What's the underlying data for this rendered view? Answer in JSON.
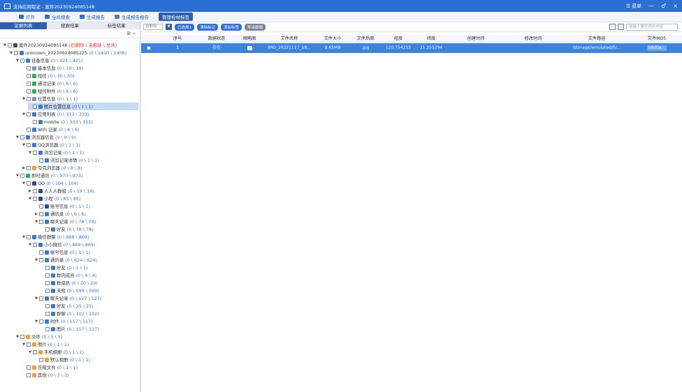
{
  "window": {
    "title": "支持应用取证 - 案件20230924085148",
    "menu_label": "菜单",
    "minimize": "—",
    "maximize": "♂",
    "close": "×"
  },
  "toolbar": {
    "buttons": [
      {
        "label": "打开"
      },
      {
        "label": "全局搜索"
      },
      {
        "label": "生成报告"
      },
      {
        "label": "生成报告报告"
      },
      {
        "label": "管理检材标签"
      }
    ]
  },
  "left_tabs": [
    "证据列表",
    "搜索结果",
    "标签结果"
  ],
  "tree": [
    {
      "text": "案件20230924085148",
      "count": "(已删除 \\ 未删除 \\ 总共)",
      "arrow": "▼",
      "indent": 0,
      "icon": "dark"
    },
    {
      "text": "unknown_20230924085225",
      "count": "(0 \\ 1400 \\ 1406)",
      "arrow": "▼",
      "indent": 1,
      "icon": "blue"
    },
    {
      "text": "设备信息",
      "count": "(0 \\ 421 \\ 421)",
      "arrow": "▼",
      "indent": 2,
      "icon": "blue"
    },
    {
      "text": "基本信息",
      "count": "(0 \\ 19 \\ 19)",
      "arrow": "",
      "indent": 3,
      "icon": "gray"
    },
    {
      "text": "短信",
      "count": "(0 \\ 30 \\ 30)",
      "arrow": "",
      "indent": 3,
      "icon": "green"
    },
    {
      "text": "通话记录",
      "count": "(0 \\ 6 \\ 6)",
      "arrow": "",
      "indent": 3,
      "icon": "green"
    },
    {
      "text": "短信附件",
      "count": "(0 \\ 6 \\ 6)",
      "arrow": "",
      "indent": 3,
      "icon": "green"
    },
    {
      "text": "位置信息",
      "count": "(0 \\ 1 \\ 1)",
      "arrow": "▼",
      "indent": 3,
      "icon": "gray"
    },
    {
      "text": "图片位置信息",
      "count": "(0 \\ 1 \\ 1)",
      "arrow": "",
      "indent": 4,
      "icon": "blue",
      "selected": true
    },
    {
      "text": "应用列表",
      "count": "(0 \\ 333 \\ 333)",
      "arrow": "▼",
      "indent": 3,
      "icon": "blue"
    },
    {
      "text": "mobile",
      "count": "(0 \\ 333 \\ 333)",
      "arrow": "",
      "indent": 4,
      "icon": "blue"
    },
    {
      "text": "WiFi 记录",
      "count": "(0 \\ 6 \\ 6)",
      "arrow": "",
      "indent": 3,
      "icon": "blue"
    },
    {
      "text": "浏览器信息",
      "count": "(0 \\ 9 \\ 9)",
      "arrow": "▼",
      "indent": 2,
      "icon": "blue"
    },
    {
      "text": "QQ浏览器",
      "count": "(0 \\ 1 \\ 1)",
      "arrow": "▼",
      "indent": 3,
      "icon": "blue"
    },
    {
      "text": "浏览记录",
      "count": "(0 \\ 1 \\ 1)",
      "arrow": "▼",
      "indent": 4,
      "icon": "blue"
    },
    {
      "text": "浏览记录详情",
      "count": "(0 \\ 1 \\ 1)",
      "arrow": "",
      "indent": 5,
      "icon": "blue"
    },
    {
      "text": "夸克浏览器",
      "count": "(0 \\ 8 \\ 8)",
      "arrow": "▶",
      "indent": 3,
      "icon": "orange"
    },
    {
      "text": "即时通讯",
      "count": "(0 \\ 973 \\ 973)",
      "arrow": "▼",
      "indent": 2,
      "icon": "green"
    },
    {
      "text": "QQ",
      "count": "(0 \\ 104 \\ 104)",
      "arrow": "▼",
      "indent": 3,
      "icon": "dark"
    },
    {
      "text": "人人人群组",
      "count": "(0 \\ 19 \\ 19)",
      "arrow": "▶",
      "indent": 4,
      "icon": "dark"
    },
    {
      "text": "小程",
      "count": "(0 \\ 85 \\ 85)",
      "arrow": "▼",
      "indent": 4,
      "icon": "dark"
    },
    {
      "text": "账号信息",
      "count": "(0 \\ 1 \\ 1)",
      "arrow": "",
      "indent": 5,
      "icon": "dark"
    },
    {
      "text": "通讯录",
      "count": "(0 \\ 6 \\ 6)",
      "arrow": "▶",
      "indent": 5,
      "icon": "blue"
    },
    {
      "text": "聊天记录",
      "count": "(0 \\ 78 \\ 78)",
      "arrow": "▼",
      "indent": 5,
      "icon": "blue"
    },
    {
      "text": "好友",
      "count": "(0 \\ 78 \\ 78)",
      "arrow": "",
      "indent": 6,
      "icon": "blue"
    },
    {
      "text": "微信群聊",
      "count": "(0 \\ 869 \\ 869)",
      "arrow": "▼",
      "indent": 3,
      "icon": "blue"
    },
    {
      "text": "小小微信",
      "count": "(0 \\ 869 \\ 869)",
      "arrow": "▼",
      "indent": 4,
      "icon": "blue"
    },
    {
      "text": "账号信息",
      "count": "(0 \\ 1 \\ 1)",
      "arrow": "",
      "indent": 5,
      "icon": "blue"
    },
    {
      "text": "通讯录",
      "count": "(0 \\ 624 \\ 624)",
      "arrow": "▼",
      "indent": 5,
      "icon": "blue"
    },
    {
      "text": "好友",
      "count": "(0 \\ 1 \\ 1)",
      "arrow": "",
      "indent": 6,
      "icon": "blue"
    },
    {
      "text": "群内成员",
      "count": "(0 \\ 4 \\ 4)",
      "arrow": "",
      "indent": 6,
      "icon": "blue"
    },
    {
      "text": "群成员",
      "count": "(0 \\ 20 \\ 20)",
      "arrow": "",
      "indent": 6,
      "icon": "blue"
    },
    {
      "text": "未知",
      "count": "(0 \\ 599 \\ 599)",
      "arrow": "",
      "indent": 6,
      "icon": "blue"
    },
    {
      "text": "聊天记录",
      "count": "(0 \\ 127 \\ 127)",
      "arrow": "▼",
      "indent": 5,
      "icon": "blue"
    },
    {
      "text": "好友",
      "count": "(0 \\ 25 \\ 25)",
      "arrow": "",
      "indent": 6,
      "icon": "blue"
    },
    {
      "text": "群聊",
      "count": "(0 \\ 102 \\ 102)",
      "arrow": "",
      "indent": 6,
      "icon": "blue"
    },
    {
      "text": "附件",
      "count": "(0 \\ 117 \\ 117)",
      "arrow": "▼",
      "indent": 5,
      "icon": "blue"
    },
    {
      "text": "图片",
      "count": "(0 \\ 117 \\ 117)",
      "arrow": "",
      "indent": 6,
      "icon": "blue"
    },
    {
      "text": "文件",
      "count": "(0 \\ 5 \\ 5)",
      "arrow": "▼",
      "indent": 2,
      "icon": "orange"
    },
    {
      "text": "图片",
      "count": "(0 \\ 1 \\ 1)",
      "arrow": "▼",
      "indent": 3,
      "icon": "orange"
    },
    {
      "text": "手机相册",
      "count": "(0 \\ 1 \\ 1)",
      "arrow": "▼",
      "indent": 4,
      "icon": "orange"
    },
    {
      "text": "默认相册",
      "count": "(0 \\ 1 \\ 1)",
      "arrow": "",
      "indent": 5,
      "icon": "orange"
    },
    {
      "text": "压缩文件",
      "count": "(0 \\ 1 \\ 1)",
      "arrow": "",
      "indent": 3,
      "icon": "orange"
    },
    {
      "text": "其他",
      "count": "(0 \\ 3 \\ 3)",
      "arrow": "",
      "indent": 3,
      "icon": "orange"
    }
  ],
  "filter": {
    "select_placeholder": "按删除",
    "chips": [
      "清除标记",
      "添加标签",
      "导出数据"
    ],
    "chip_first": "已选择1",
    "search_placeholder": "请输入要查找的内容"
  },
  "table": {
    "headers": [
      "",
      "序号",
      "数据状态",
      "缩略图",
      "文件名称",
      "文件大小",
      "文件后缀",
      "经度",
      "纬度",
      "创建时间",
      "修改时间",
      "文件路径",
      "文件MD5"
    ],
    "rows": [
      [
        "",
        "1",
        "存在",
        "",
        "IMG_20221117_18...",
        "8.65MB",
        ".jpg",
        "120.754255",
        "31.255294",
        "",
        "",
        "/storage/emulated/0/...",
        "b8d0a..."
      ]
    ]
  }
}
